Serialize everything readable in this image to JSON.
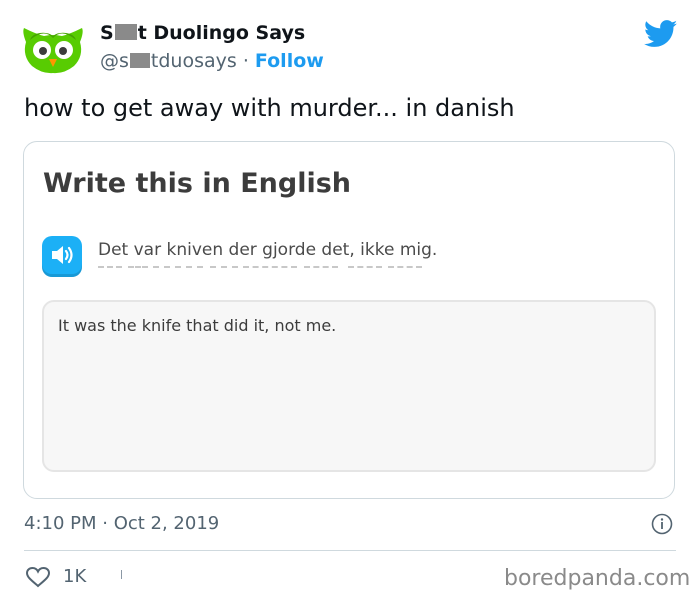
{
  "account": {
    "name_prefix": "S",
    "name_suffix": "t Duolingo Says",
    "handle_prefix": "@s",
    "handle_suffix": "tduosays",
    "separator": "·",
    "follow_label": "Follow"
  },
  "tweet": {
    "text": "how to get away with murder... in danish",
    "timestamp": "4:10 PM · Oct 2, 2019",
    "like_count": "1K"
  },
  "card": {
    "title": "Write this in English",
    "phrase": "Det var kniven der gjorde det, ikke mig.",
    "answer": "It was the knife that did it, not me."
  },
  "watermark": "boredpanda.com",
  "icons": {
    "avatar": "duolingo-owl-avatar",
    "platform": "twitter-bird-icon",
    "speaker": "speaker-icon",
    "info": "info-icon",
    "like": "heart-icon"
  },
  "colors": {
    "twitter_blue": "#1d9bf0",
    "duolingo_green": "#58cc02",
    "speaker_blue": "#1cb0f6",
    "text_gray": "#536471"
  }
}
